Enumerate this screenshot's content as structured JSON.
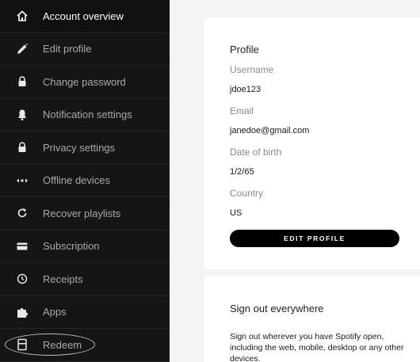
{
  "sidebar": {
    "items": [
      {
        "label": "Account overview",
        "icon": "home-icon"
      },
      {
        "label": "Edit profile",
        "icon": "pencil-icon"
      },
      {
        "label": "Change password",
        "icon": "lock-icon"
      },
      {
        "label": "Notification settings",
        "icon": "bell-icon"
      },
      {
        "label": "Privacy settings",
        "icon": "lock-icon"
      },
      {
        "label": "Offline devices",
        "icon": "devices-icon"
      },
      {
        "label": "Recover playlists",
        "icon": "refresh-icon"
      },
      {
        "label": "Subscription",
        "icon": "card-icon"
      },
      {
        "label": "Receipts",
        "icon": "clock-icon"
      },
      {
        "label": "Apps",
        "icon": "puzzle-icon"
      },
      {
        "label": "Redeem",
        "icon": "gift-card-icon"
      }
    ],
    "active_index": 0,
    "highlighted_index": 10
  },
  "profile": {
    "title": "Profile",
    "fields": [
      {
        "label": "Username",
        "value": "jdoe123"
      },
      {
        "label": "Email",
        "value": "janedoe@gmail.com"
      },
      {
        "label": "Date of birth",
        "value": "1/2/65"
      },
      {
        "label": "Country",
        "value": "US"
      }
    ],
    "edit_button_label": "EDIT PROFILE"
  },
  "signout": {
    "title": "Sign out everywhere",
    "description": "Sign out wherever you have Spotify open, including the web, mobile, desktop or any other devices."
  },
  "colors": {
    "sidebar_bg": "#151515",
    "content_bg": "#f3f3f3",
    "card_bg": "#ffffff",
    "button_bg": "#000000",
    "highlight_ring": "#bdbdbd"
  }
}
